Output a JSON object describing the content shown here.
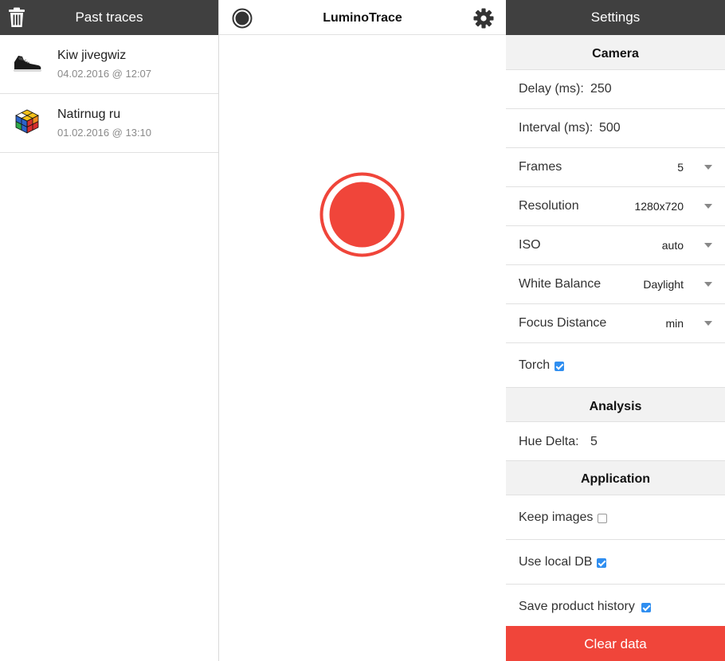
{
  "left": {
    "title": "Past traces",
    "traces": [
      {
        "name": "Kiw jivegwiz",
        "date": "04.02.2016 @ 12:07",
        "thumb": "shoe-thumbnail"
      },
      {
        "name": "Natirnug ru",
        "date": "01.02.2016 @ 13:10",
        "thumb": "rubiks-cube-thumbnail"
      }
    ]
  },
  "middle": {
    "title": "LuminoTrace"
  },
  "settings": {
    "title": "Settings",
    "camera_section": "Camera",
    "delay_label": "Delay (ms):",
    "delay_value": "250",
    "interval_label": "Interval (ms):",
    "interval_value": "500",
    "frames_label": "Frames",
    "frames_value": "5",
    "resolution_label": "Resolution",
    "resolution_value": "1280x720",
    "iso_label": "ISO",
    "iso_value": "auto",
    "wb_label": "White Balance",
    "wb_value": "Daylight",
    "focus_label": "Focus Distance",
    "focus_value": "min",
    "torch_label": "Torch",
    "torch_checked": true,
    "analysis_section": "Analysis",
    "hue_label": "Hue Delta:",
    "hue_value": "5",
    "application_section": "Application",
    "keep_images_label": "Keep images",
    "keep_images_checked": false,
    "local_db_label": "Use local DB",
    "local_db_checked": true,
    "save_history_label": "Save product history",
    "save_history_checked": true,
    "clear_button": "Clear data"
  },
  "colors": {
    "header_dark": "#404040",
    "record_red": "#f0453a",
    "checkbox_blue": "#2f8ef0"
  }
}
